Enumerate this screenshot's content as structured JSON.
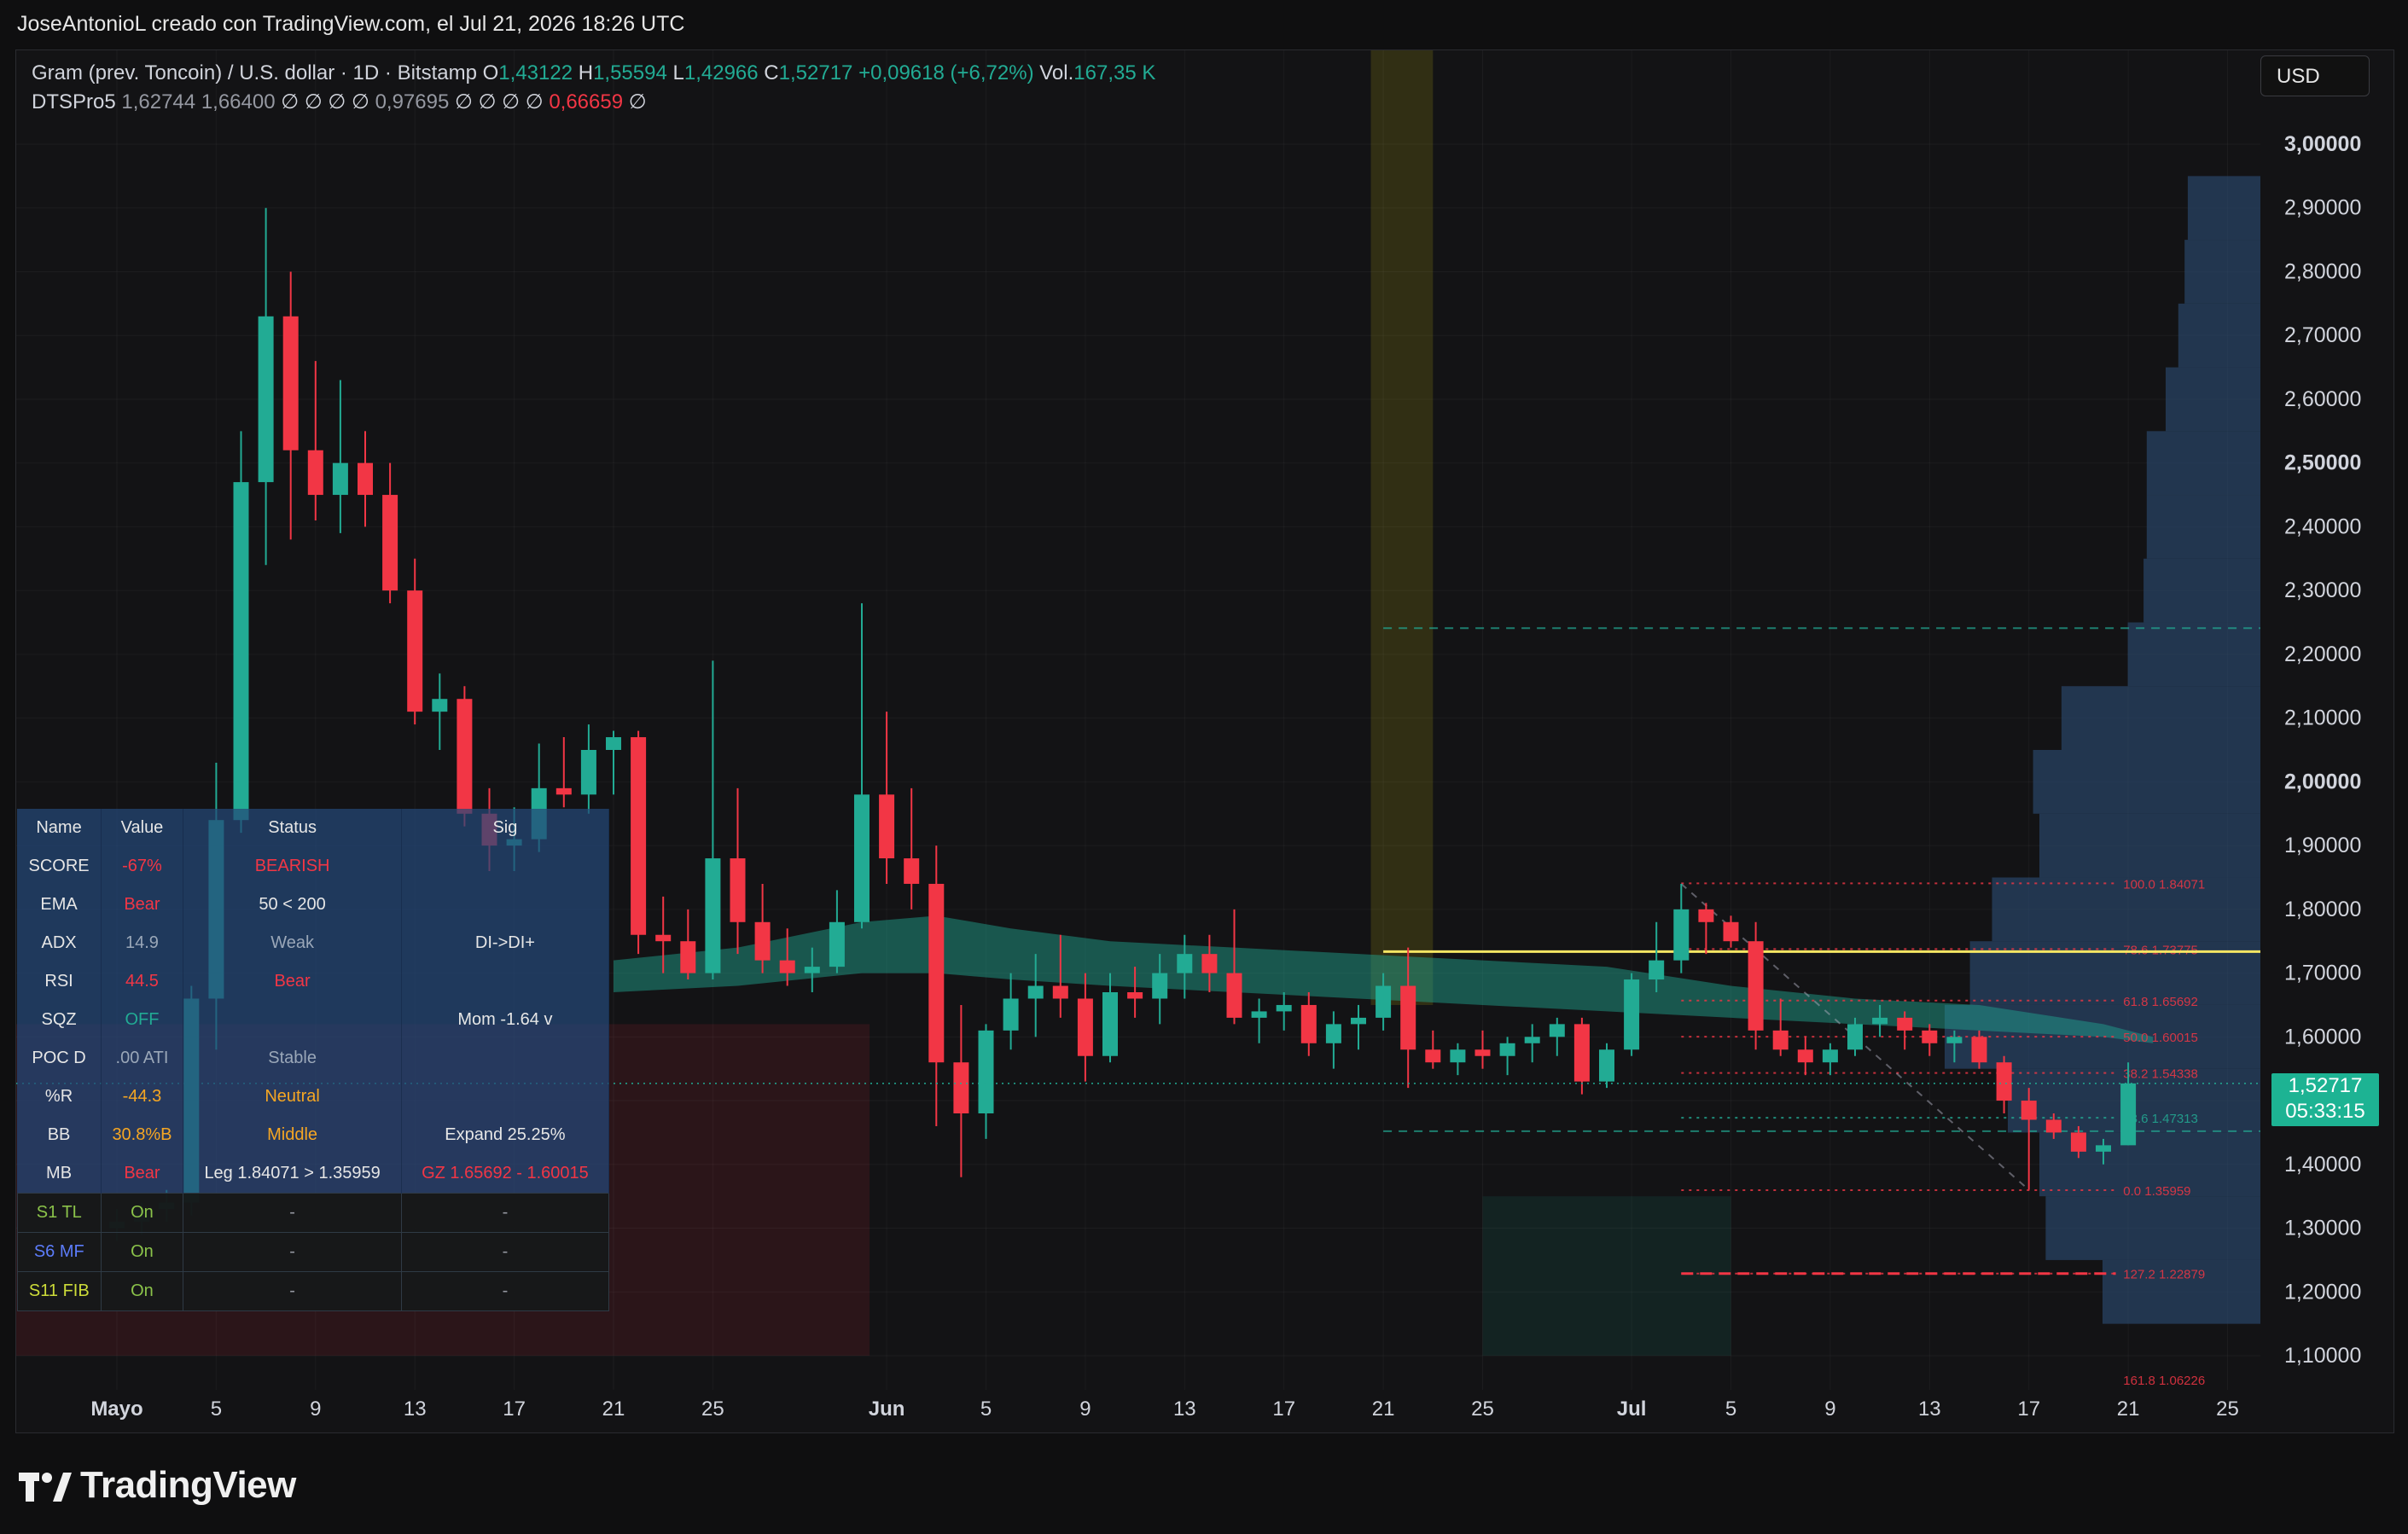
{
  "header": {
    "credit": "JoseAntonioL creado con TradingView.com, el Jul 21, 2026 18:26 UTC",
    "currency": "USD",
    "logo": "TradingView"
  },
  "legend": {
    "symbol": "Gram (prev. Toncoin) / U.S. dollar · 1D · Bitstamp",
    "o_label": "O",
    "o_value": "1,43122",
    "h_label": "H",
    "h_value": "1,55594",
    "l_label": "L",
    "l_value": "1,42966",
    "c_label": "C",
    "c_value": "1,52717",
    "change": "+0,09618 (+6,72%)",
    "vol_label": "Vol.",
    "vol_value": "167,35 K",
    "indicator_name": "DTSPro5",
    "indicator_v1": "1,62744",
    "indicator_v2": "1,66400",
    "indicator_mid": "∅ ∅ ∅ ∅",
    "indicator_v3": "0,97695",
    "indicator_mid2": "∅ ∅ ∅ ∅",
    "indicator_v4": "0,66659",
    "indicator_end": "∅"
  },
  "last_price": {
    "price": "1,52717",
    "countdown": "05:33:15"
  },
  "status_table": {
    "headers": [
      "Name",
      "Value",
      "Status",
      "Sig"
    ],
    "rows": [
      [
        "SCORE",
        "-67%",
        "BEARISH",
        ""
      ],
      [
        "EMA",
        "Bear",
        "50 < 200",
        ""
      ],
      [
        "ADX",
        "14.9",
        "Weak",
        "DI->DI+"
      ],
      [
        "RSI",
        "44.5",
        "Bear",
        ""
      ],
      [
        "SQZ",
        "OFF",
        "",
        "Mom -1.64 v"
      ],
      [
        "POC D",
        ".00 ATI",
        "Stable",
        ""
      ],
      [
        "%R",
        "-44.3",
        "Neutral",
        ""
      ],
      [
        "BB",
        "30.8%B",
        "Middle",
        "Expand 25.25%"
      ],
      [
        "MB",
        "Bear",
        "Leg 1.84071 > 1.35959",
        "GZ 1.65692 - 1.60015"
      ]
    ],
    "strategy_rows": [
      [
        "S1 TL",
        "On",
        "-",
        "-"
      ],
      [
        "S6 MF",
        "On",
        "-",
        "-"
      ],
      [
        "S11 FIB",
        "On",
        "-",
        "-"
      ]
    ]
  },
  "colors": {
    "up": "#22ab94",
    "down": "#f23645",
    "background": "#131315",
    "poc_line": "#f5e663",
    "volume_profile": "#2b4a6e"
  },
  "chart_data": {
    "type": "candlestick",
    "title": "Gram (prev. Toncoin) / U.S. dollar · 1D · Bitstamp",
    "ylim": [
      1.05,
      3.05
    ],
    "y_ticks": [
      "3,00000",
      "2,90000",
      "2,80000",
      "2,70000",
      "2,60000",
      "2,50000",
      "2,40000",
      "2,30000",
      "2,20000",
      "2,10000",
      "2,00000",
      "1,90000",
      "1,80000",
      "1,70000",
      "1,60000",
      "1,50000",
      "1,40000",
      "1,30000",
      "1,20000",
      "1,10000"
    ],
    "y_tick_values": [
      3.0,
      2.9,
      2.8,
      2.7,
      2.6,
      2.5,
      2.4,
      2.3,
      2.2,
      2.1,
      2.0,
      1.9,
      1.8,
      1.7,
      1.6,
      1.5,
      1.4,
      1.3,
      1.2,
      1.1
    ],
    "x_labels": [
      {
        "label": "Mayo",
        "day": 0
      },
      {
        "label": "5",
        "day": 4
      },
      {
        "label": "9",
        "day": 8
      },
      {
        "label": "13",
        "day": 12
      },
      {
        "label": "17",
        "day": 16
      },
      {
        "label": "21",
        "day": 20
      },
      {
        "label": "25",
        "day": 24
      },
      {
        "label": "Jun",
        "day": 31
      },
      {
        "label": "5",
        "day": 35
      },
      {
        "label": "9",
        "day": 39
      },
      {
        "label": "13",
        "day": 43
      },
      {
        "label": "17",
        "day": 47
      },
      {
        "label": "21",
        "day": 51
      },
      {
        "label": "25",
        "day": 55
      },
      {
        "label": "Jul",
        "day": 61
      },
      {
        "label": "5",
        "day": 65
      },
      {
        "label": "9",
        "day": 69
      },
      {
        "label": "13",
        "day": 73
      },
      {
        "label": "17",
        "day": 77
      },
      {
        "label": "21",
        "day": 81
      },
      {
        "label": "25",
        "day": 85
      }
    ],
    "candles": [
      {
        "day": 0,
        "o": 1.3,
        "h": 1.33,
        "l": 1.28,
        "c": 1.31
      },
      {
        "day": 1,
        "o": 1.31,
        "h": 1.34,
        "l": 1.29,
        "c": 1.33
      },
      {
        "day": 2,
        "o": 1.33,
        "h": 1.36,
        "l": 1.31,
        "c": 1.34
      },
      {
        "day": 3,
        "o": 1.34,
        "h": 1.68,
        "l": 1.32,
        "c": 1.66
      },
      {
        "day": 4,
        "o": 1.66,
        "h": 2.03,
        "l": 1.58,
        "c": 1.94
      },
      {
        "day": 5,
        "o": 1.94,
        "h": 2.55,
        "l": 1.92,
        "c": 2.47
      },
      {
        "day": 6,
        "o": 2.47,
        "h": 2.9,
        "l": 2.34,
        "c": 2.73
      },
      {
        "day": 7,
        "o": 2.73,
        "h": 2.8,
        "l": 2.38,
        "c": 2.52
      },
      {
        "day": 8,
        "o": 2.52,
        "h": 2.66,
        "l": 2.41,
        "c": 2.45
      },
      {
        "day": 9,
        "o": 2.45,
        "h": 2.63,
        "l": 2.39,
        "c": 2.5
      },
      {
        "day": 10,
        "o": 2.5,
        "h": 2.55,
        "l": 2.4,
        "c": 2.45
      },
      {
        "day": 11,
        "o": 2.45,
        "h": 2.5,
        "l": 2.28,
        "c": 2.3
      },
      {
        "day": 12,
        "o": 2.3,
        "h": 2.35,
        "l": 2.09,
        "c": 2.11
      },
      {
        "day": 13,
        "o": 2.11,
        "h": 2.17,
        "l": 2.05,
        "c": 2.13
      },
      {
        "day": 14,
        "o": 2.13,
        "h": 2.15,
        "l": 1.93,
        "c": 1.95
      },
      {
        "day": 15,
        "o": 1.95,
        "h": 1.99,
        "l": 1.86,
        "c": 1.9
      },
      {
        "day": 16,
        "o": 1.9,
        "h": 1.96,
        "l": 1.86,
        "c": 1.91
      },
      {
        "day": 17,
        "o": 1.91,
        "h": 2.06,
        "l": 1.89,
        "c": 1.99
      },
      {
        "day": 18,
        "o": 1.99,
        "h": 2.07,
        "l": 1.96,
        "c": 1.98
      },
      {
        "day": 19,
        "o": 1.98,
        "h": 2.09,
        "l": 1.95,
        "c": 2.05
      },
      {
        "day": 20,
        "o": 2.05,
        "h": 2.08,
        "l": 1.98,
        "c": 2.07
      },
      {
        "day": 21,
        "o": 2.07,
        "h": 2.08,
        "l": 1.73,
        "c": 1.76
      },
      {
        "day": 22,
        "o": 1.76,
        "h": 1.82,
        "l": 1.7,
        "c": 1.75
      },
      {
        "day": 23,
        "o": 1.75,
        "h": 1.8,
        "l": 1.69,
        "c": 1.7
      },
      {
        "day": 24,
        "o": 1.7,
        "h": 2.19,
        "l": 1.69,
        "c": 1.88
      },
      {
        "day": 25,
        "o": 1.88,
        "h": 1.99,
        "l": 1.73,
        "c": 1.78
      },
      {
        "day": 26,
        "o": 1.78,
        "h": 1.84,
        "l": 1.7,
        "c": 1.72
      },
      {
        "day": 27,
        "o": 1.72,
        "h": 1.77,
        "l": 1.68,
        "c": 1.7
      },
      {
        "day": 28,
        "o": 1.7,
        "h": 1.74,
        "l": 1.67,
        "c": 1.71
      },
      {
        "day": 29,
        "o": 1.71,
        "h": 1.83,
        "l": 1.7,
        "c": 1.78
      },
      {
        "day": 30,
        "o": 1.78,
        "h": 2.28,
        "l": 1.77,
        "c": 1.98
      },
      {
        "day": 31,
        "o": 1.98,
        "h": 2.11,
        "l": 1.84,
        "c": 1.88
      },
      {
        "day": 32,
        "o": 1.88,
        "h": 1.99,
        "l": 1.8,
        "c": 1.84
      },
      {
        "day": 33,
        "o": 1.84,
        "h": 1.9,
        "l": 1.46,
        "c": 1.56
      },
      {
        "day": 34,
        "o": 1.56,
        "h": 1.65,
        "l": 1.38,
        "c": 1.48
      },
      {
        "day": 35,
        "o": 1.48,
        "h": 1.62,
        "l": 1.44,
        "c": 1.61
      },
      {
        "day": 36,
        "o": 1.61,
        "h": 1.7,
        "l": 1.58,
        "c": 1.66
      },
      {
        "day": 37,
        "o": 1.66,
        "h": 1.73,
        "l": 1.6,
        "c": 1.68
      },
      {
        "day": 38,
        "o": 1.68,
        "h": 1.76,
        "l": 1.63,
        "c": 1.66
      },
      {
        "day": 39,
        "o": 1.66,
        "h": 1.7,
        "l": 1.53,
        "c": 1.57
      },
      {
        "day": 40,
        "o": 1.57,
        "h": 1.7,
        "l": 1.56,
        "c": 1.67
      },
      {
        "day": 41,
        "o": 1.67,
        "h": 1.71,
        "l": 1.63,
        "c": 1.66
      },
      {
        "day": 42,
        "o": 1.66,
        "h": 1.73,
        "l": 1.62,
        "c": 1.7
      },
      {
        "day": 43,
        "o": 1.7,
        "h": 1.76,
        "l": 1.66,
        "c": 1.73
      },
      {
        "day": 44,
        "o": 1.73,
        "h": 1.76,
        "l": 1.67,
        "c": 1.7
      },
      {
        "day": 45,
        "o": 1.7,
        "h": 1.8,
        "l": 1.62,
        "c": 1.63
      },
      {
        "day": 46,
        "o": 1.63,
        "h": 1.66,
        "l": 1.59,
        "c": 1.64
      },
      {
        "day": 47,
        "o": 1.64,
        "h": 1.67,
        "l": 1.61,
        "c": 1.65
      },
      {
        "day": 48,
        "o": 1.65,
        "h": 1.67,
        "l": 1.57,
        "c": 1.59
      },
      {
        "day": 49,
        "o": 1.59,
        "h": 1.64,
        "l": 1.55,
        "c": 1.62
      },
      {
        "day": 50,
        "o": 1.62,
        "h": 1.65,
        "l": 1.58,
        "c": 1.63
      },
      {
        "day": 51,
        "o": 1.63,
        "h": 1.7,
        "l": 1.61,
        "c": 1.68
      },
      {
        "day": 52,
        "o": 1.68,
        "h": 1.74,
        "l": 1.52,
        "c": 1.58
      },
      {
        "day": 53,
        "o": 1.58,
        "h": 1.61,
        "l": 1.55,
        "c": 1.56
      },
      {
        "day": 54,
        "o": 1.56,
        "h": 1.59,
        "l": 1.54,
        "c": 1.58
      },
      {
        "day": 55,
        "o": 1.58,
        "h": 1.61,
        "l": 1.55,
        "c": 1.57
      },
      {
        "day": 56,
        "o": 1.57,
        "h": 1.6,
        "l": 1.54,
        "c": 1.59
      },
      {
        "day": 57,
        "o": 1.59,
        "h": 1.62,
        "l": 1.56,
        "c": 1.6
      },
      {
        "day": 58,
        "o": 1.6,
        "h": 1.63,
        "l": 1.57,
        "c": 1.62
      },
      {
        "day": 59,
        "o": 1.62,
        "h": 1.63,
        "l": 1.51,
        "c": 1.53
      },
      {
        "day": 60,
        "o": 1.53,
        "h": 1.59,
        "l": 1.52,
        "c": 1.58
      },
      {
        "day": 61,
        "o": 1.58,
        "h": 1.7,
        "l": 1.57,
        "c": 1.69
      },
      {
        "day": 62,
        "o": 1.69,
        "h": 1.78,
        "l": 1.67,
        "c": 1.72
      },
      {
        "day": 63,
        "o": 1.72,
        "h": 1.84,
        "l": 1.7,
        "c": 1.8
      },
      {
        "day": 64,
        "o": 1.8,
        "h": 1.81,
        "l": 1.73,
        "c": 1.78
      },
      {
        "day": 65,
        "o": 1.78,
        "h": 1.79,
        "l": 1.74,
        "c": 1.75
      },
      {
        "day": 66,
        "o": 1.75,
        "h": 1.78,
        "l": 1.58,
        "c": 1.61
      },
      {
        "day": 67,
        "o": 1.61,
        "h": 1.66,
        "l": 1.57,
        "c": 1.58
      },
      {
        "day": 68,
        "o": 1.58,
        "h": 1.6,
        "l": 1.54,
        "c": 1.56
      },
      {
        "day": 69,
        "o": 1.56,
        "h": 1.59,
        "l": 1.54,
        "c": 1.58
      },
      {
        "day": 70,
        "o": 1.58,
        "h": 1.63,
        "l": 1.57,
        "c": 1.62
      },
      {
        "day": 71,
        "o": 1.62,
        "h": 1.65,
        "l": 1.6,
        "c": 1.63
      },
      {
        "day": 72,
        "o": 1.63,
        "h": 1.64,
        "l": 1.58,
        "c": 1.61
      },
      {
        "day": 73,
        "o": 1.61,
        "h": 1.62,
        "l": 1.57,
        "c": 1.59
      },
      {
        "day": 74,
        "o": 1.59,
        "h": 1.61,
        "l": 1.56,
        "c": 1.6
      },
      {
        "day": 75,
        "o": 1.6,
        "h": 1.61,
        "l": 1.55,
        "c": 1.56
      },
      {
        "day": 76,
        "o": 1.56,
        "h": 1.57,
        "l": 1.48,
        "c": 1.5
      },
      {
        "day": 77,
        "o": 1.5,
        "h": 1.52,
        "l": 1.36,
        "c": 1.47
      },
      {
        "day": 78,
        "o": 1.47,
        "h": 1.48,
        "l": 1.44,
        "c": 1.45
      },
      {
        "day": 79,
        "o": 1.45,
        "h": 1.46,
        "l": 1.41,
        "c": 1.42
      },
      {
        "day": 80,
        "o": 1.42,
        "h": 1.44,
        "l": 1.4,
        "c": 1.43
      },
      {
        "day": 81,
        "o": 1.43,
        "h": 1.56,
        "l": 1.43,
        "c": 1.527
      }
    ],
    "ema_band": {
      "days": [
        20,
        25,
        30,
        33,
        36,
        40,
        45,
        50,
        55,
        60,
        65,
        70,
        75,
        80,
        82
      ],
      "upper": [
        1.72,
        1.74,
        1.78,
        1.79,
        1.77,
        1.75,
        1.74,
        1.73,
        1.72,
        1.71,
        1.68,
        1.66,
        1.65,
        1.62,
        1.6
      ],
      "lower": [
        1.67,
        1.68,
        1.7,
        1.7,
        1.69,
        1.68,
        1.67,
        1.66,
        1.65,
        1.64,
        1.63,
        1.62,
        1.61,
        1.6,
        1.59
      ]
    },
    "poc_line": {
      "value": 1.7337,
      "from_day": 51,
      "to_day": 89
    },
    "fib_levels": [
      {
        "label": "100.0  1.84071",
        "value": 1.8407,
        "color": "#f23645"
      },
      {
        "label": "78.6  1.73775",
        "value": 1.7378,
        "color": "#f23645"
      },
      {
        "label": "61.8  1.65692",
        "value": 1.6569,
        "color": "#f23645"
      },
      {
        "label": "50.0  1.60015",
        "value": 1.6002,
        "color": "#f23645"
      },
      {
        "label": "38.2  1.54338",
        "value": 1.5434,
        "color": "#f23645"
      },
      {
        "label": "23.6  1.47313",
        "value": 1.4731,
        "color": "#22ab94"
      },
      {
        "label": "0.0  1.35959",
        "value": 1.3596,
        "color": "#f23645"
      },
      {
        "label": "127.2  1.22879",
        "value": 1.2288,
        "color": "#f23645"
      },
      {
        "label": "161.8  1.06226",
        "value": 1.0623,
        "color": "#f23645"
      }
    ],
    "green_dash_levels": [
      2.241,
      1.452
    ],
    "volume_profile": [
      {
        "p": 2.9,
        "w": 0.23
      },
      {
        "p": 2.8,
        "w": 0.24
      },
      {
        "p": 2.7,
        "w": 0.26
      },
      {
        "p": 2.6,
        "w": 0.3
      },
      {
        "p": 2.5,
        "w": 0.36
      },
      {
        "p": 2.4,
        "w": 0.36
      },
      {
        "p": 2.3,
        "w": 0.37
      },
      {
        "p": 2.2,
        "w": 0.42
      },
      {
        "p": 2.1,
        "w": 0.63
      },
      {
        "p": 2.0,
        "w": 0.72
      },
      {
        "p": 1.9,
        "w": 0.7
      },
      {
        "p": 1.8,
        "w": 0.85
      },
      {
        "p": 1.7,
        "w": 0.92
      },
      {
        "p": 1.6,
        "w": 1.0
      },
      {
        "p": 1.5,
        "w": 0.8
      },
      {
        "p": 1.4,
        "w": 0.7
      },
      {
        "p": 1.3,
        "w": 0.68
      },
      {
        "p": 1.2,
        "w": 0.5
      }
    ]
  }
}
